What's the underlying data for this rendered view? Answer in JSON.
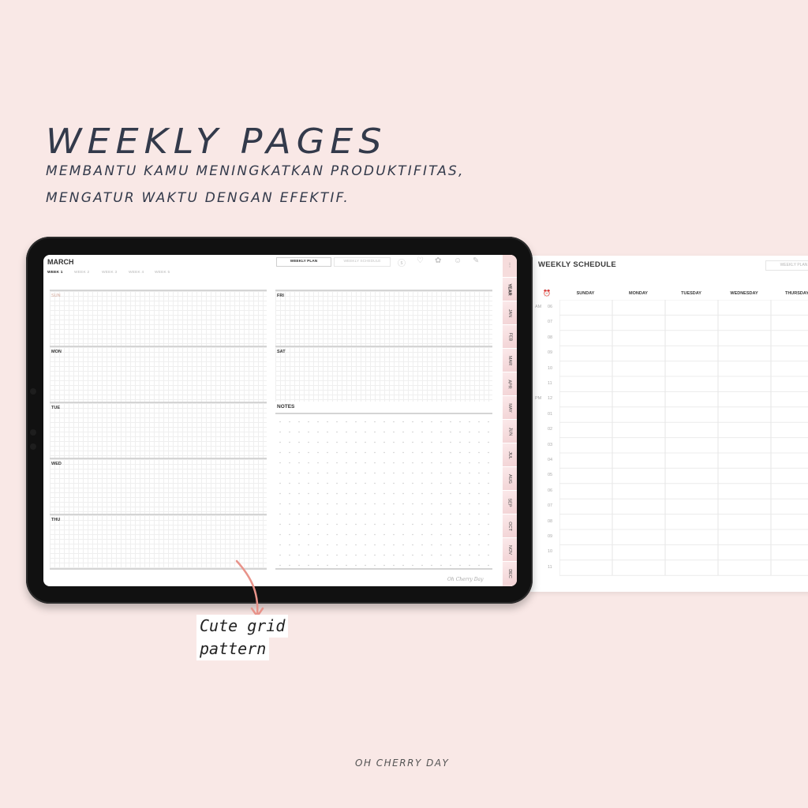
{
  "hero": {
    "title": "WEEKLY PAGES",
    "subtitle_line1": "MEMBANTU KAMU MENINGKATKAN PRODUKTIFITAS,",
    "subtitle_line2": "MENGATUR WAKTU DENGAN EFEKTIF."
  },
  "planner": {
    "month": "MARCH",
    "weeks": [
      "WEEK 1",
      "WEEK 2",
      "WEEK 3",
      "WEEK 4",
      "WEEK 5"
    ],
    "active_week": "WEEK 1",
    "view_buttons": {
      "weekly_plan": "WEEKLY PLAN",
      "weekly_schedule": "WEEKLY SCHEDULE"
    },
    "header_icons": [
      "dollar-icon",
      "heart-icon",
      "flower-icon",
      "smiley-icon",
      "notepad-icon"
    ],
    "header_icon_glyphs": [
      "ⓢ",
      "♡",
      "✿",
      "☺",
      "✎"
    ],
    "days_left": [
      "SUN",
      "MON",
      "TUE",
      "WED",
      "THU"
    ],
    "days_right": [
      "FRI",
      "SAT"
    ],
    "notes_label": "NOTES",
    "signature": "Oh Cherry Day",
    "tabs_more": "⋮",
    "side_tabs": [
      "YEAR",
      "JAN",
      "FEB",
      "MAR",
      "APR",
      "MAY",
      "JUN",
      "JUL",
      "AUG",
      "SEP",
      "OCT",
      "NOV",
      "DEC"
    ],
    "active_tab": "YEAR"
  },
  "schedule": {
    "title": "WEEKLY SCHEDULE",
    "button": "WEEKLY PLAN",
    "clock_icon": "⏰",
    "days": [
      "SUNDAY",
      "MONDAY",
      "TUESDAY",
      "WEDNESDAY",
      "THURSDAY"
    ],
    "am_label": "AM",
    "pm_label": "PM",
    "hours": [
      "06",
      "07",
      "08",
      "09",
      "10",
      "11",
      "12",
      "01",
      "02",
      "03",
      "04",
      "05",
      "06",
      "07",
      "08",
      "09",
      "10",
      "11"
    ]
  },
  "callout": {
    "line1": "Cute grid",
    "line2": "pattern"
  },
  "brand": "OH CHERRY DAY",
  "colors": {
    "background": "#f9e8e6",
    "text_dark": "#333a4b",
    "accent_pink": "#e8938a",
    "tab_pink": "#f6dcdc"
  }
}
